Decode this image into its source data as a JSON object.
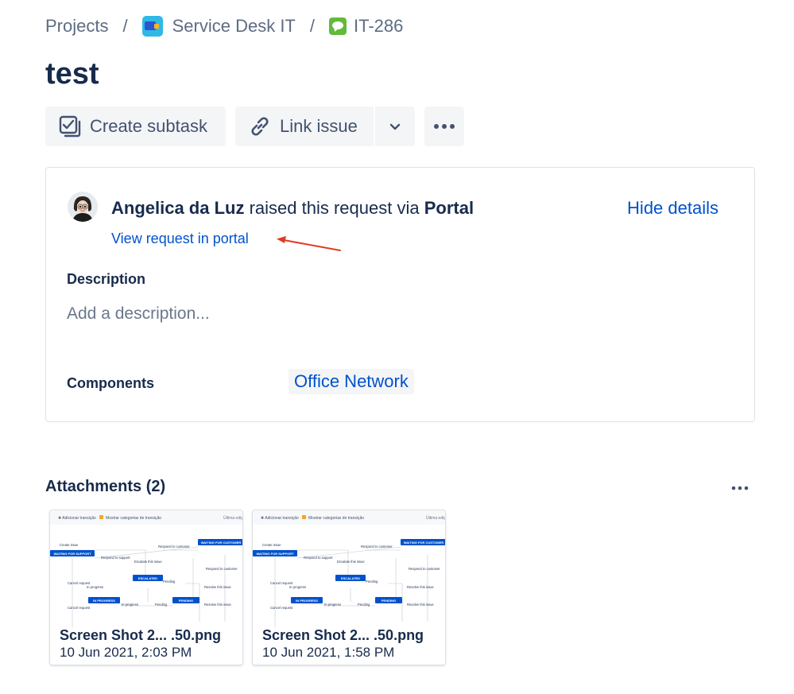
{
  "breadcrumb": {
    "projects": "Projects",
    "separator": "/",
    "project": "Service Desk IT",
    "issue_key": "IT-286"
  },
  "issue": {
    "title": "test"
  },
  "actions": {
    "create_subtask": "Create subtask",
    "link_issue": "Link issue"
  },
  "request": {
    "reporter": "Angelica da Luz",
    "raised_text": " raised this request via ",
    "channel": "Portal",
    "hide_details": "Hide details",
    "view_portal": "View request in portal"
  },
  "description": {
    "label": "Description",
    "placeholder": "Add a description..."
  },
  "components": {
    "label": "Components",
    "value": "Office Network"
  },
  "attachments": {
    "header": "Attachments (2)",
    "items": [
      {
        "name": "Screen Shot 2...  .50.png",
        "date": "10 Jun 2021, 2:03 PM"
      },
      {
        "name": "Screen Shot 2...  .50.png",
        "date": "10 Jun 2021, 1:58 PM"
      }
    ],
    "preview": {
      "toolbar_add": "Adicionar transição",
      "toolbar_show": "Mostrar categorias de transição",
      "toolbar_right": "Última edição",
      "labels": [
        "Create issue",
        "Respond to customer",
        "WAITING FOR CUSTOMER",
        "WAITING FOR SUPPORT",
        "Respond to support",
        "Escalate this issue",
        "Respond to customer",
        "Cancel request",
        "ESCALATED",
        "Pending",
        "In progress",
        "Resolve this issue",
        "IN PROGRESS",
        "In progress",
        "Pending",
        "PENDING",
        "Cancel request",
        "Resolve this issue"
      ]
    }
  },
  "colors": {
    "link": "#0052cc",
    "text": "#172b4d",
    "subtle": "#5e6c84",
    "annotation_arrow": "#e03b24"
  }
}
